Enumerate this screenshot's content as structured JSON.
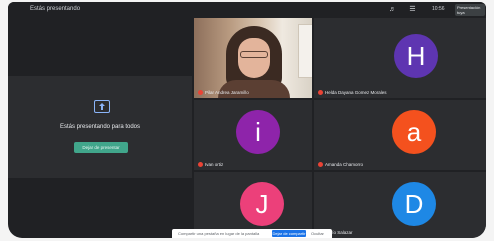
{
  "topbar": {
    "presenting_label": "Estás presentando",
    "time": "10:56",
    "you_label": "Presentación tuya"
  },
  "present_panel": {
    "message": "Estás presentando para todos",
    "stop_button": "Dejar de presentar"
  },
  "participants": [
    {
      "name": "Pilar Andrea Jaramillo",
      "initial": "",
      "avatar_color": "",
      "has_video": true
    },
    {
      "name": "Helda Dayana Gomez Morales",
      "initial": "H",
      "avatar_color": "#5e35b1",
      "has_video": false
    },
    {
      "name": "Ivan ortiz",
      "initial": "i",
      "avatar_color": "#8e24aa",
      "has_video": false
    },
    {
      "name": "Amanda Chamorro",
      "initial": "a",
      "avatar_color": "#f4511e",
      "has_video": false
    },
    {
      "name": "",
      "initial": "J",
      "avatar_color": "#ec407a",
      "has_video": false
    },
    {
      "name": "Darío Salazar",
      "initial": "D",
      "avatar_color": "#1e88e5",
      "has_video": false
    }
  ],
  "notification": {
    "text": "Compartir una pestaña en lugar de la pantalla",
    "primary_button": "Dejar de compartir",
    "dismiss": "Ocultar"
  }
}
